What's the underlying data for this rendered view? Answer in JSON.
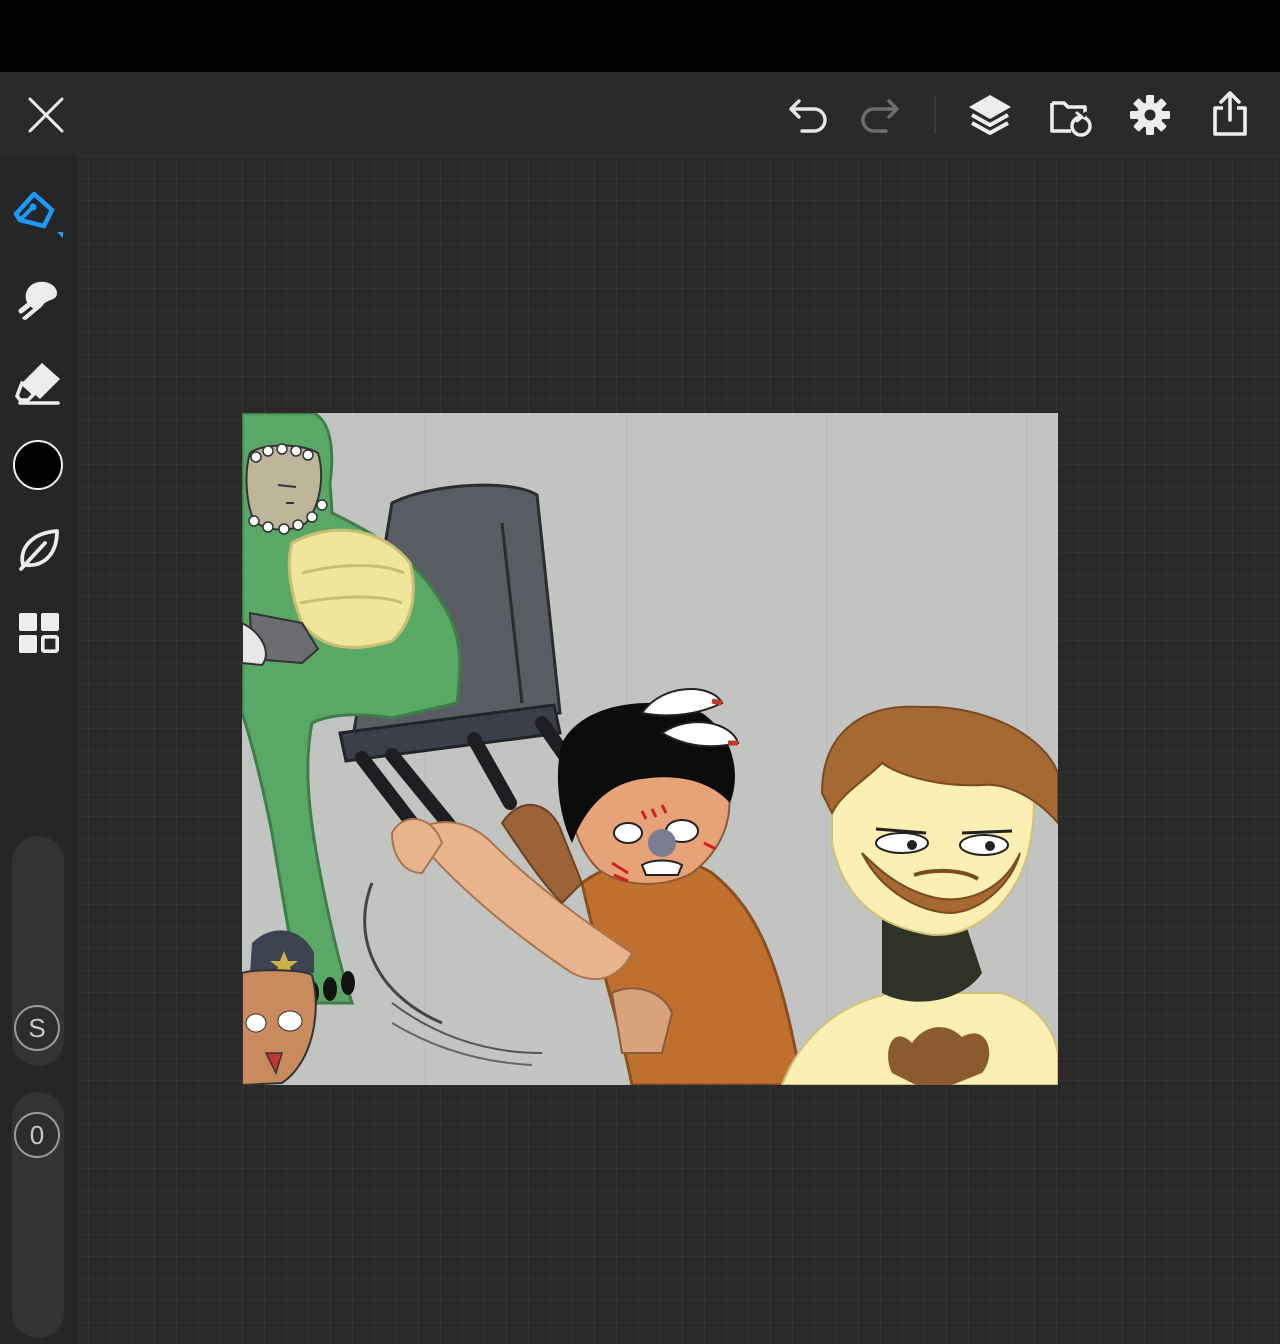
{
  "toolbar": {
    "close_icon": "close-icon",
    "undo_icon": "undo-icon",
    "redo_icon": "redo-icon",
    "layers_icon": "layers-icon",
    "import_icon": "import-folder-icon",
    "settings_icon": "gear-icon",
    "share_icon": "share-icon"
  },
  "sidebar": {
    "tools": [
      {
        "name": "pen-tool",
        "icon": "pen-icon",
        "active": true
      },
      {
        "name": "smudge-tool",
        "icon": "smudge-icon",
        "active": false
      },
      {
        "name": "eraser-tool",
        "icon": "eraser-icon",
        "active": false
      },
      {
        "name": "color-picker",
        "icon": "color-swatch",
        "active": false
      },
      {
        "name": "brush-library",
        "icon": "leaf-icon",
        "active": false
      },
      {
        "name": "gallery",
        "icon": "grid-icon",
        "active": false
      }
    ],
    "size_label": "S",
    "opacity_label": "0",
    "current_color": "#000000"
  },
  "colors": {
    "accent": "#1a9bff",
    "topbar_bg": "#2a2a2a",
    "workspace_bg": "#2a2a2a",
    "canvas_bg": "#c2c4c1"
  }
}
